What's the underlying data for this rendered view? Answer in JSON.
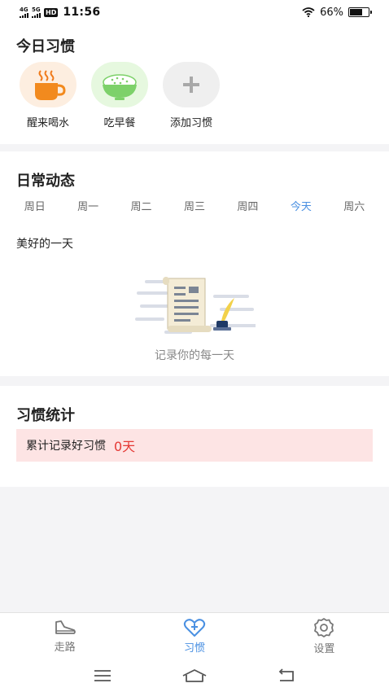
{
  "status": {
    "network1": "4G",
    "network2": "5G",
    "hd": "HD",
    "time": "11:56",
    "battery_pct": "66%",
    "battery_level": 0.66
  },
  "habits": {
    "title": "今日习惯",
    "items": [
      {
        "label": "醒来喝水",
        "icon": "coffee-cup-icon",
        "bg": "#fdeee0"
      },
      {
        "label": "吃早餐",
        "icon": "rice-bowl-icon",
        "bg": "#e6f8df"
      },
      {
        "label": "添加习惯",
        "icon": "plus-icon",
        "bg": "#efefef"
      }
    ]
  },
  "dynamics": {
    "title": "日常动态",
    "days": [
      "周日",
      "周一",
      "周二",
      "周三",
      "周四",
      "今天",
      "周六"
    ],
    "active_day_index": 5,
    "subtitle": "美好的一天",
    "empty_text": "记录你的每一天"
  },
  "stats": {
    "title": "习惯统计",
    "label": "累计记录好习惯",
    "value": "0天"
  },
  "tabbar": {
    "tabs": [
      {
        "label": "走路",
        "icon": "shoe-icon"
      },
      {
        "label": "习惯",
        "icon": "heart-plus-icon"
      },
      {
        "label": "设置",
        "icon": "gear-icon"
      }
    ],
    "active_index": 1
  },
  "colors": {
    "accent": "#4a90e2",
    "stat_red": "#e53935",
    "stat_bg": "#fde4e4"
  }
}
